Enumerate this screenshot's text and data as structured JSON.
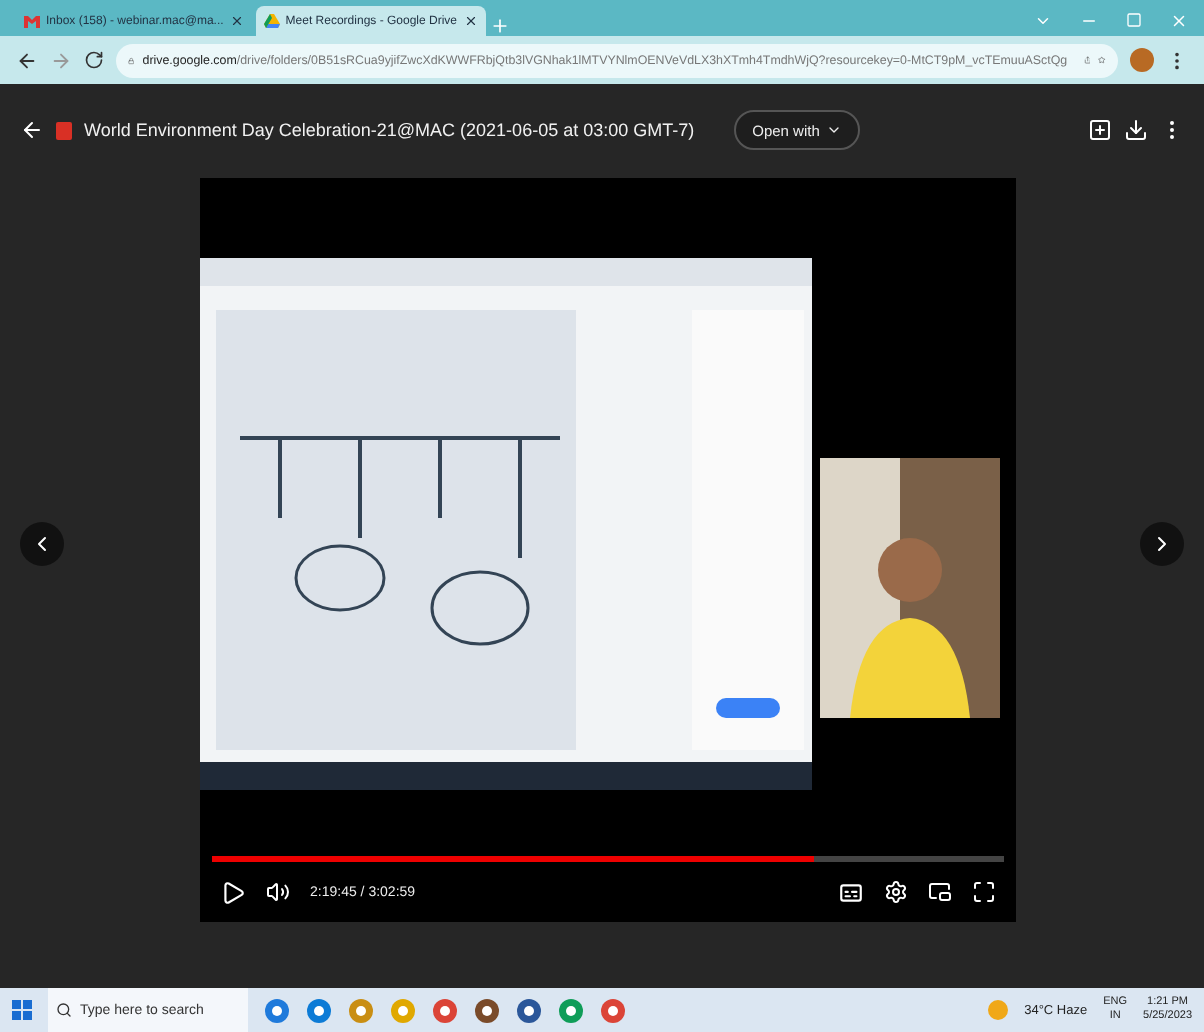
{
  "browser": {
    "tabs": [
      {
        "title": "Inbox (158) - webinar.mac@ma...",
        "kind": "mail",
        "selected": false
      },
      {
        "title": "Meet Recordings - Google Drive",
        "kind": "drive",
        "selected": true
      }
    ],
    "url_domain": "drive.google.com",
    "url_path": "/drive/folders/0B51sRCua9yjifZwcXdKWWFRbjQtb3lVGNhak1lMTVYNlmOENVeVdLX3hXTmh4TmdhWjQ?resourcekey=0-MtCT9pM_vcTEmuuASctQg"
  },
  "viewer": {
    "title": "World Environment Day Celebration-21@MAC (2021-06-05 at 03:00 GMT-7)",
    "open_with": "Open with"
  },
  "player": {
    "playing": false,
    "level": 0.76,
    "time": "2:19:45 / 3:02:59"
  },
  "taskbar": {
    "search_placeholder": "Type here to search",
    "weather": "34°C  Haze",
    "language": "ENG",
    "region": "IN",
    "time": "1:21 PM",
    "date": "5/25/2023"
  }
}
